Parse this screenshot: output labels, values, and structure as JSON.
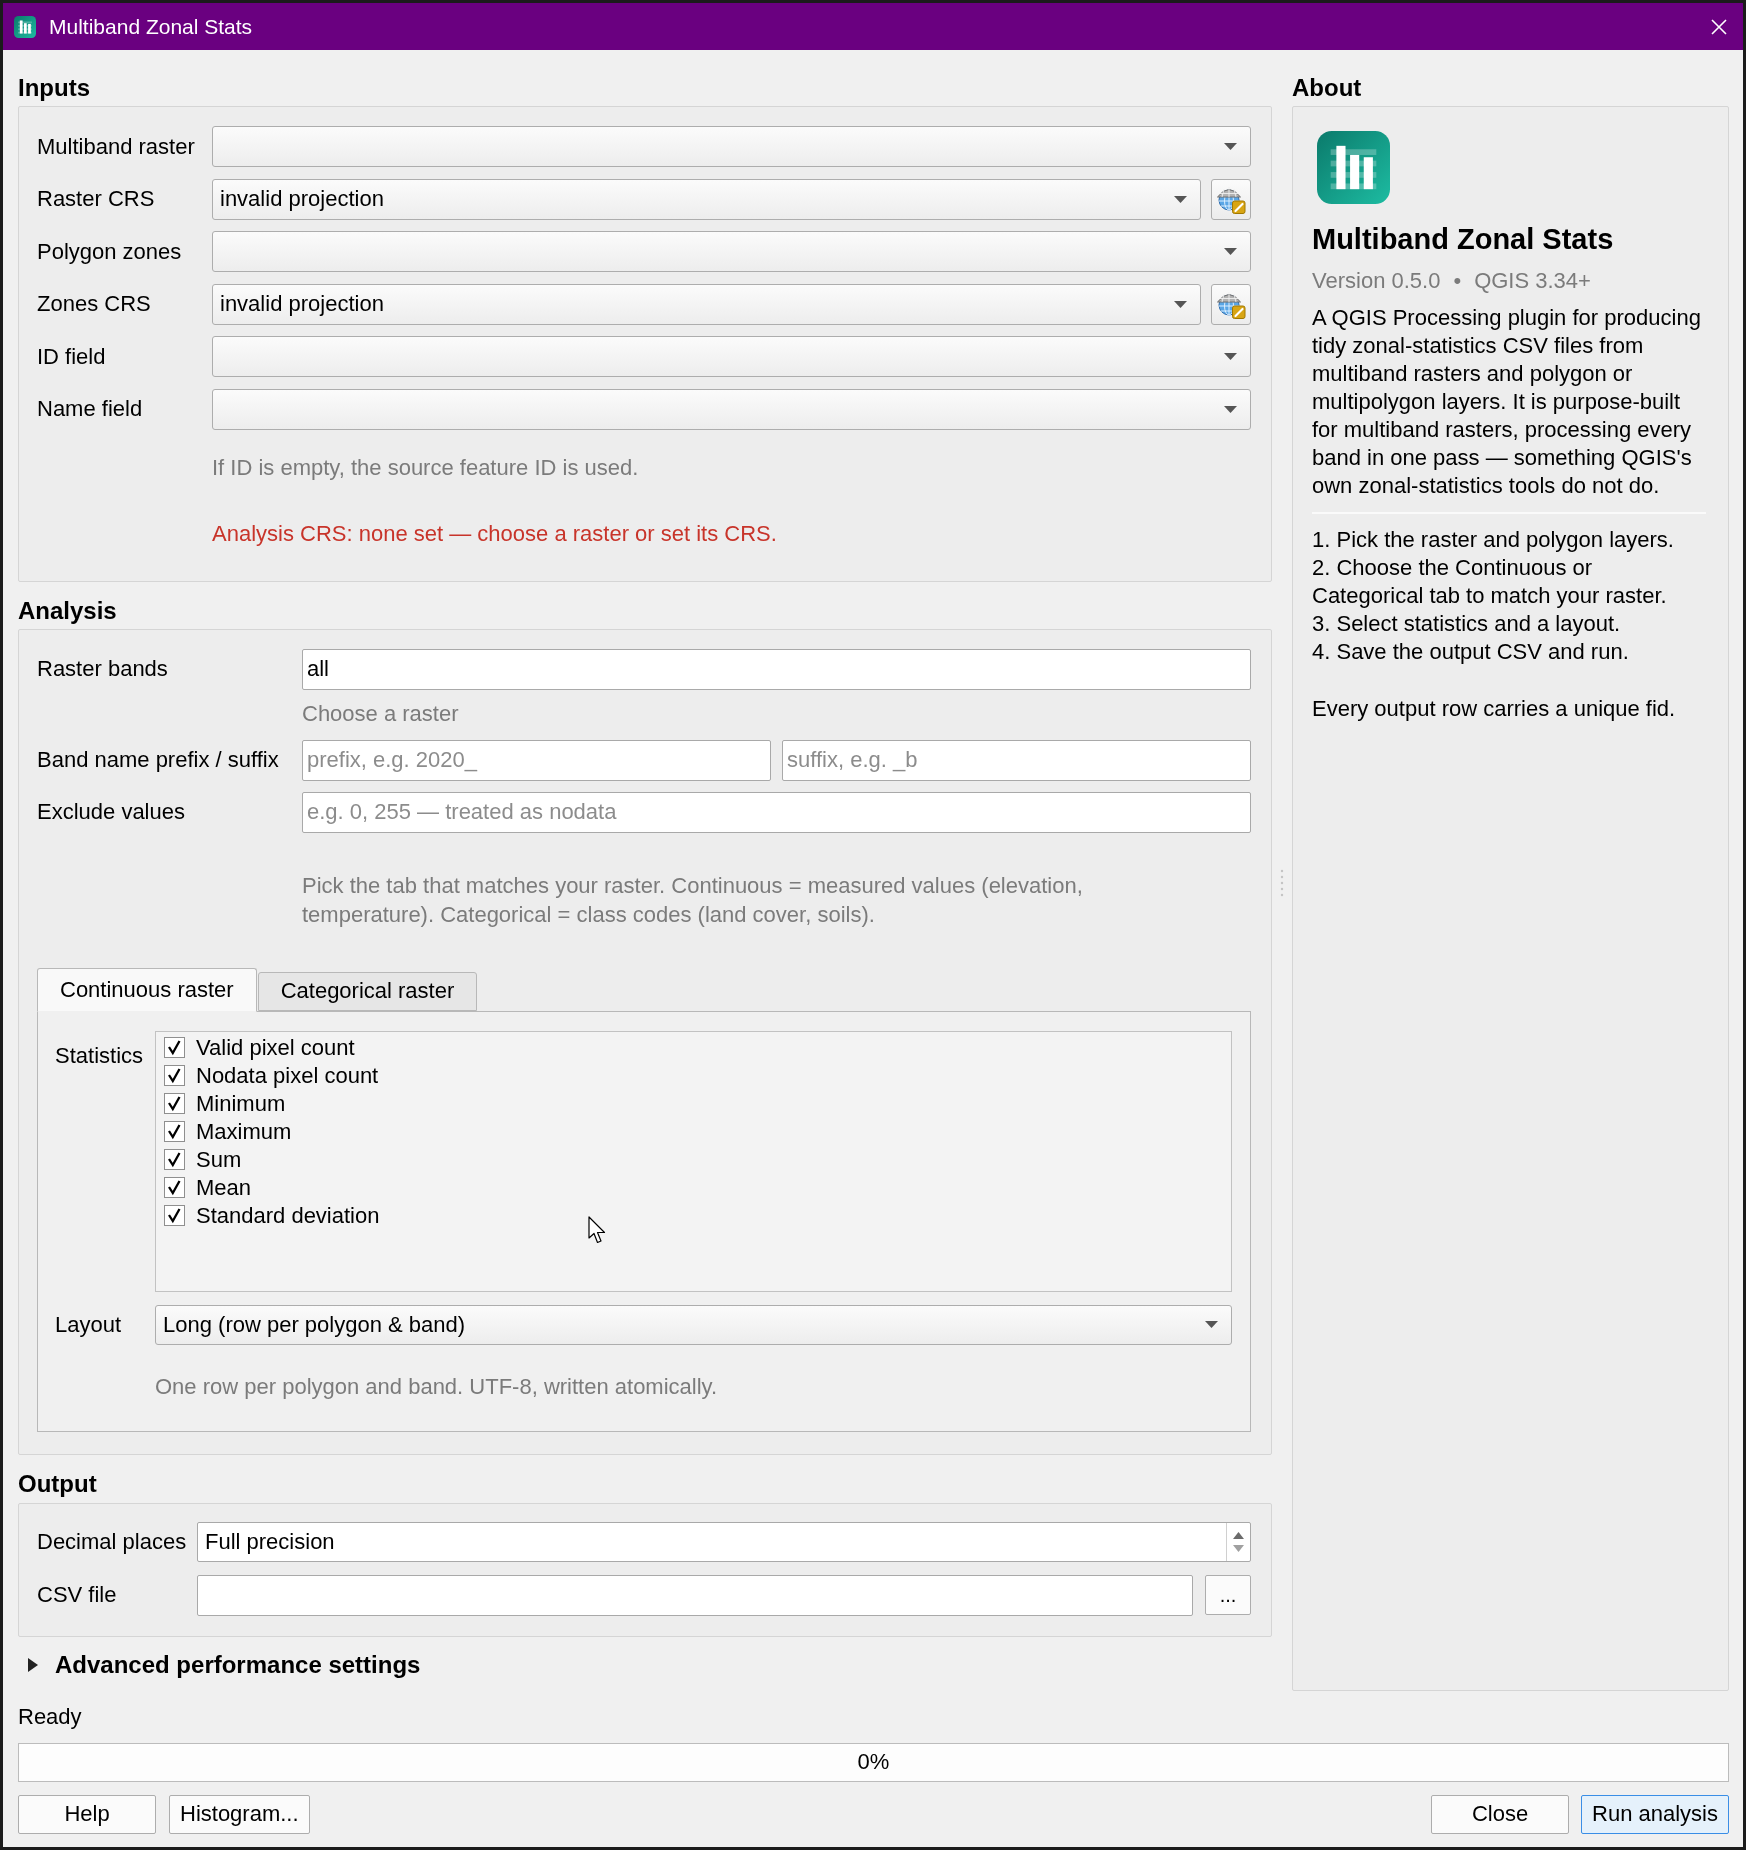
{
  "window": {
    "title": "Multiband Zonal Stats"
  },
  "inputs": {
    "heading": "Inputs",
    "rows": [
      {
        "kind": "combo",
        "label": "Multiband raster"
      },
      {
        "kind": "crs",
        "label": "Raster CRS",
        "value": "invalid projection"
      },
      {
        "kind": "combo",
        "label": "Polygon zones"
      },
      {
        "kind": "crs",
        "label": "Zones CRS",
        "value": "invalid projection"
      },
      {
        "kind": "combo",
        "label": "ID field"
      },
      {
        "kind": "combo",
        "label": "Name field"
      }
    ],
    "hint": "If ID is empty, the source feature ID is used.",
    "warning": "Analysis CRS: none set — choose a raster or set its CRS."
  },
  "analysis": {
    "heading": "Analysis",
    "raster_bands": {
      "label": "Raster bands",
      "value": "all",
      "hint": "Choose a raster"
    },
    "band_name": {
      "label": "Band name prefix / suffix",
      "fields": [
        {
          "placeholder": "prefix, e.g. 2020_"
        },
        {
          "placeholder": "suffix, e.g. _b"
        }
      ]
    },
    "exclude_values": {
      "label": "Exclude values",
      "placeholder": "e.g. 0, 255 — treated as nodata"
    },
    "tab_hint": "Pick the tab that matches your raster. Continuous = measured values (elevation, temperature). Categorical = class codes (land cover, soils).",
    "tabs": [
      {
        "label": "Continuous raster",
        "selected": true
      },
      {
        "label": "Categorical raster",
        "selected": false
      }
    ],
    "statistics": {
      "label": "Statistics",
      "items": [
        {
          "label": "Valid pixel count",
          "checked": true
        },
        {
          "label": "Nodata pixel count",
          "checked": true
        },
        {
          "label": "Minimum",
          "checked": true
        },
        {
          "label": "Maximum",
          "checked": true
        },
        {
          "label": "Sum",
          "checked": true
        },
        {
          "label": "Mean",
          "checked": true
        },
        {
          "label": "Standard deviation",
          "checked": true
        }
      ]
    },
    "layout": {
      "label": "Layout",
      "value": "Long (row per polygon & band)",
      "hint": "One row per polygon and band. UTF-8, written atomically."
    }
  },
  "output": {
    "heading": "Output",
    "decimal_places": {
      "label": "Decimal places",
      "value": "Full precision"
    },
    "csv_file": {
      "label": "CSV file",
      "browse": "..."
    }
  },
  "advanced": {
    "label": "Advanced performance settings",
    "expanded": false
  },
  "about": {
    "heading": "About",
    "title": "Multiband Zonal Stats",
    "version": "Version 0.5.0",
    "separator": "•",
    "requirement": "QGIS 3.34+",
    "description": "A QGIS Processing plugin for producing tidy zonal-statistics CSV files from multiband rasters and polygon or multipolygon layers. It is purpose-built for multiband rasters, processing every band in one pass — something QGIS's own zonal-statistics tools do not do.",
    "steps": [
      "1. Pick the raster and polygon layers.",
      "2. Choose the Continuous or Categorical tab to match your raster.",
      "3. Select statistics and a layout.",
      "4. Save the output CSV and run."
    ],
    "footer": "Every output row carries a unique fid."
  },
  "status_bar": {
    "text": "Ready"
  },
  "progress": {
    "level": 0,
    "reading": "0%"
  },
  "buttons_left": [
    {
      "label": "Help",
      "default": false
    },
    {
      "label": "Histogram...",
      "default": false
    }
  ],
  "buttons_right": [
    {
      "label": "Close",
      "default": false
    },
    {
      "label": "Run analysis",
      "default": true
    }
  ]
}
